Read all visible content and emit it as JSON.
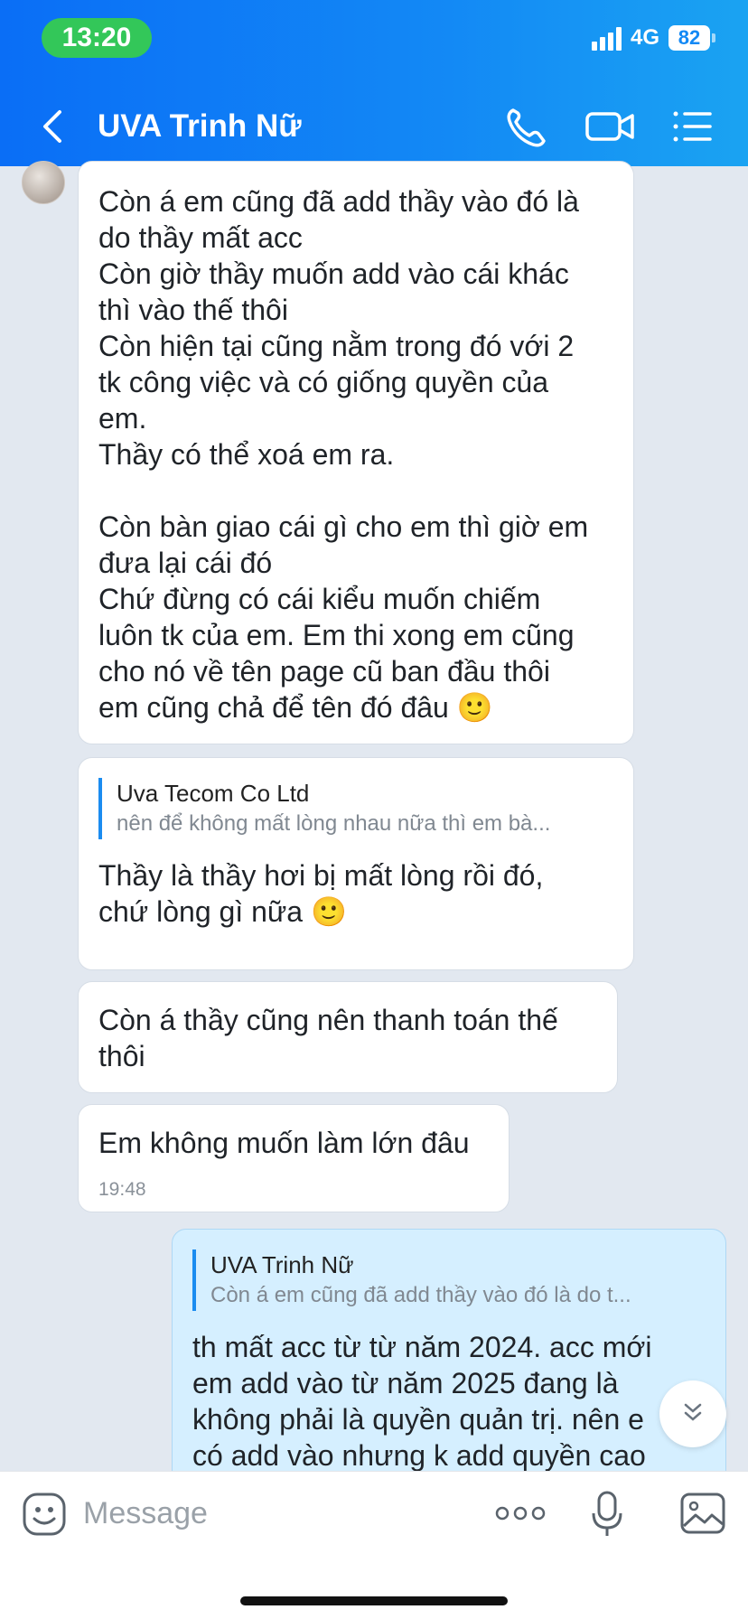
{
  "status_bar": {
    "time": "13:20",
    "network": "4G",
    "battery": "82"
  },
  "header": {
    "title": "UVA Trinh Nữ",
    "icons": [
      "back-arrow-icon",
      "phone-icon",
      "video-camera-icon",
      "menu-list-icon"
    ]
  },
  "messages": [
    {
      "text": "Còn á em cũng đã add thầy vào đó là\ndo thầy mất acc\nCòn giờ thầy muốn add vào cái khác\nthì vào thế thôi\nCòn hiện tại cũng nằm trong đó với 2\ntk công việc và có giống quyền của\nem.\nThầy có thể xoá em ra.\n\nCòn bàn giao cái gì cho em thì giờ em\nđưa lại cái đó\nChứ đừng có cái kiểu muốn chiếm\nluôn tk của em. Em thi xong em cũng\ncho nó về tên page cũ ban đầu thôi\nem cũng chả để tên đó đâu 🙂"
    },
    {
      "quote_name": "Uva Tecom Co Ltd",
      "quote_text": "nên để không mất lòng nhau nữa thì em bà...",
      "text": "Thầy là thầy hơi bị mất lòng rồi đó,\nchứ lòng gì nữa 🙂"
    },
    {
      "text": "Còn á thầy cũng nên thanh toán thế\nthôi"
    },
    {
      "text": "Em không muốn làm lớn đâu",
      "time": "19:48"
    },
    {
      "quote_name": "UVA Trinh Nữ",
      "quote_text": "Còn á em cũng đã add thầy vào đó là do t...",
      "text": "th mất acc từ từ năm 2024. acc mới\nem add vào từ năm 2025 đang là\nkhông phải là quyền quản trị. nên e\ncó add vào nhưng k add quyền cao"
    }
  ],
  "input": {
    "placeholder": "Message"
  },
  "colors": {
    "header_start": "#0a6ef6",
    "header_end": "#1aa3f2",
    "sent_bubble": "#d5efff",
    "quote_bar": "#1b8cf0"
  }
}
